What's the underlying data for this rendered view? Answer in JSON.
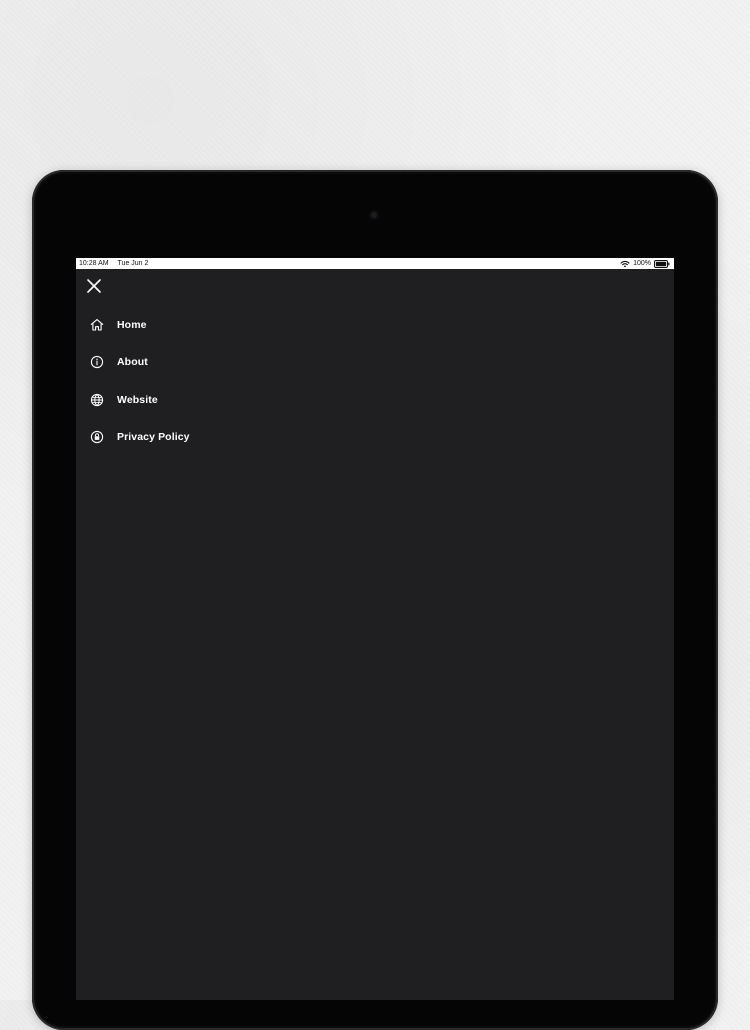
{
  "status_bar": {
    "time": "10:28 AM",
    "date": "Tue Jun 2",
    "battery": "100%"
  },
  "drawer": {
    "close_icon": "close-icon",
    "items": [
      {
        "label": "Home",
        "icon": "home-icon"
      },
      {
        "label": "About",
        "icon": "info-icon"
      },
      {
        "label": "Website",
        "icon": "globe-icon"
      },
      {
        "label": "Privacy Policy",
        "icon": "lock-circle-icon"
      }
    ]
  },
  "colors": {
    "background": "#f2f2f2",
    "device_frame": "#050505",
    "screen": "#1f1e21",
    "text": "#ffffff",
    "status_bar": "#ffffff"
  }
}
